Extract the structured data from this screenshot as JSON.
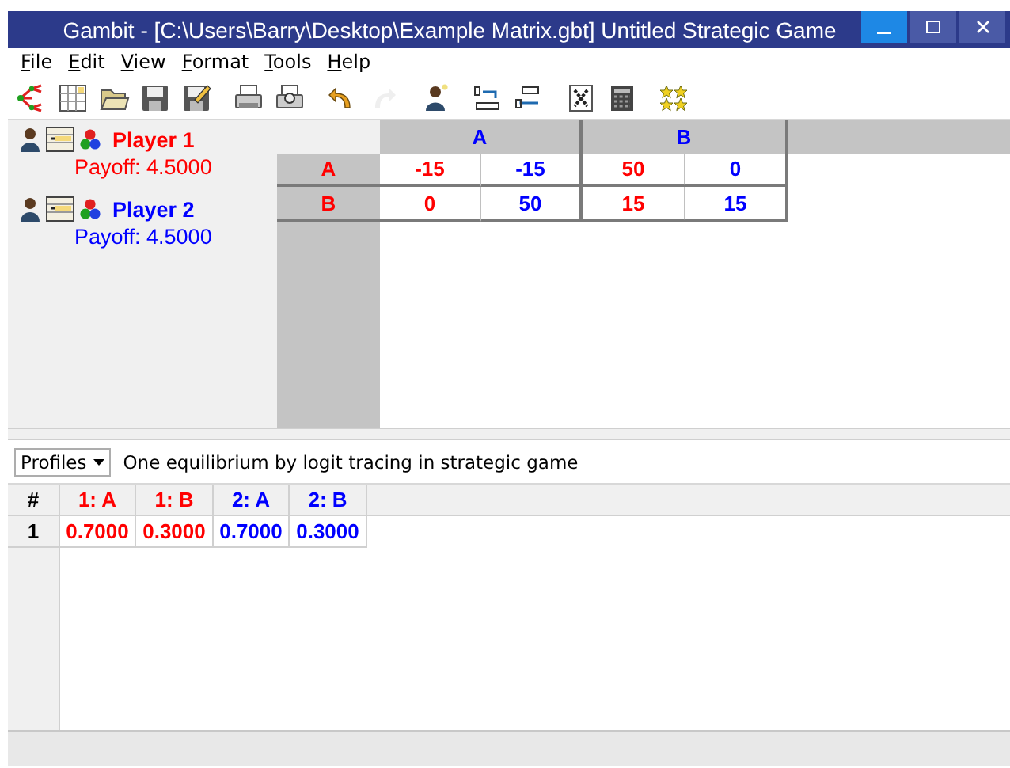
{
  "window": {
    "title": "Gambit - [C:\\Users\\Barry\\Desktop\\Example Matrix.gbt] Untitled Strategic Game"
  },
  "menu": [
    {
      "label": "File"
    },
    {
      "label": "Edit"
    },
    {
      "label": "View"
    },
    {
      "label": "Format"
    },
    {
      "label": "Tools"
    },
    {
      "label": "Help"
    }
  ],
  "toolbar": [
    {
      "kind": "tree",
      "disabled": false
    },
    {
      "kind": "table",
      "disabled": false
    },
    {
      "kind": "open",
      "disabled": false
    },
    {
      "kind": "save",
      "disabled": false
    },
    {
      "kind": "saveas",
      "disabled": false
    },
    {
      "kind": "sep"
    },
    {
      "kind": "print",
      "disabled": false
    },
    {
      "kind": "preview",
      "disabled": false
    },
    {
      "kind": "sep"
    },
    {
      "kind": "undo",
      "disabled": false
    },
    {
      "kind": "redo",
      "disabled": true
    },
    {
      "kind": "sep"
    },
    {
      "kind": "player",
      "disabled": false
    },
    {
      "kind": "sep"
    },
    {
      "kind": "decinc",
      "disabled": false
    },
    {
      "kind": "decdec",
      "disabled": false
    },
    {
      "kind": "sep"
    },
    {
      "kind": "dominance",
      "disabled": false
    },
    {
      "kind": "calculator",
      "disabled": false
    },
    {
      "kind": "sep"
    },
    {
      "kind": "stars",
      "disabled": false
    }
  ],
  "players": [
    {
      "name": "Player 1",
      "payoff": "Payoff: 4.5000",
      "color": "#ff0000"
    },
    {
      "name": "Player 2",
      "payoff": "Payoff: 4.5000",
      "color": "#0000ff"
    }
  ],
  "matrix": {
    "column_strategies": [
      {
        "label": "A"
      },
      {
        "label": "B"
      }
    ],
    "row_strategies": [
      {
        "label": "A",
        "payoffs": [
          "-15",
          "-15",
          "50",
          "0"
        ]
      },
      {
        "label": "B",
        "payoffs": [
          "0",
          "50",
          "15",
          "15"
        ]
      }
    ]
  },
  "profiles": {
    "dropdown": "Profiles",
    "description": "One equilibrium by logit tracing in strategic game",
    "index_header": "#",
    "columns": [
      {
        "label": "1: A",
        "color": "#ff0000"
      },
      {
        "label": "1: B",
        "color": "#ff0000"
      },
      {
        "label": "2: A",
        "color": "#0000ff"
      },
      {
        "label": "2: B",
        "color": "#0000ff"
      }
    ],
    "rows": [
      {
        "number": "1",
        "values": [
          "0.7000",
          "0.3000",
          "0.7000",
          "0.3000"
        ]
      }
    ]
  }
}
